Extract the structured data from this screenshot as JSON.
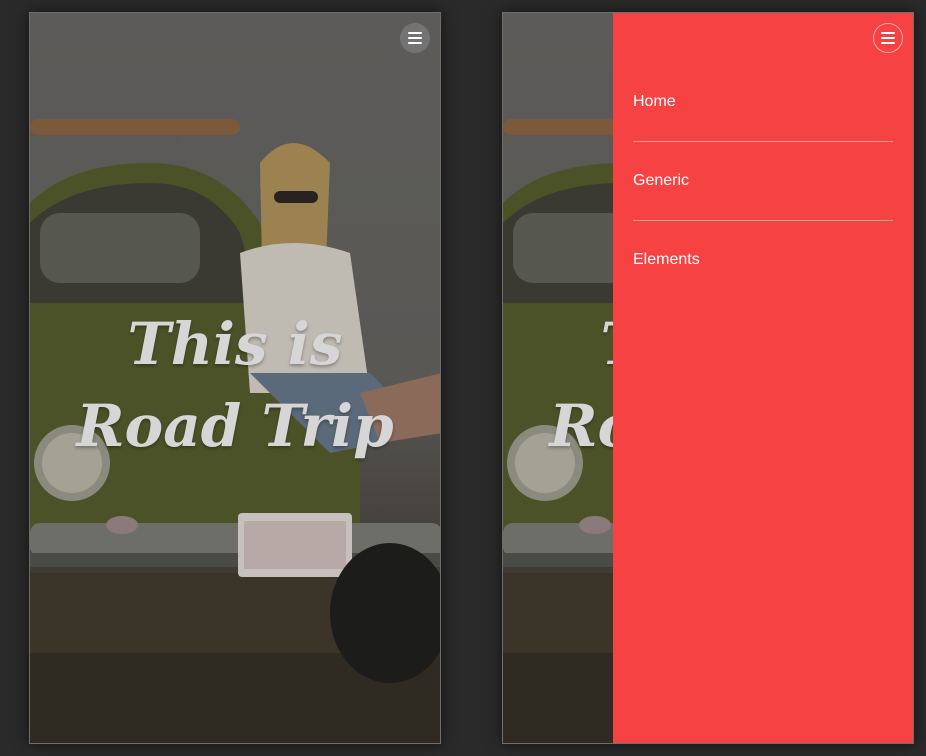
{
  "hero": {
    "title": "This is Road Trip"
  },
  "menu": {
    "toggle_icon": "hamburger-menu-icon",
    "items": [
      {
        "label": "Home"
      },
      {
        "label": "Generic"
      },
      {
        "label": "Elements"
      }
    ]
  },
  "colors": {
    "drawer_background": "#f64243",
    "nav_text": "#ffffff",
    "hero_title": "#d6d6d6",
    "page_background": "#2a2a2a"
  }
}
